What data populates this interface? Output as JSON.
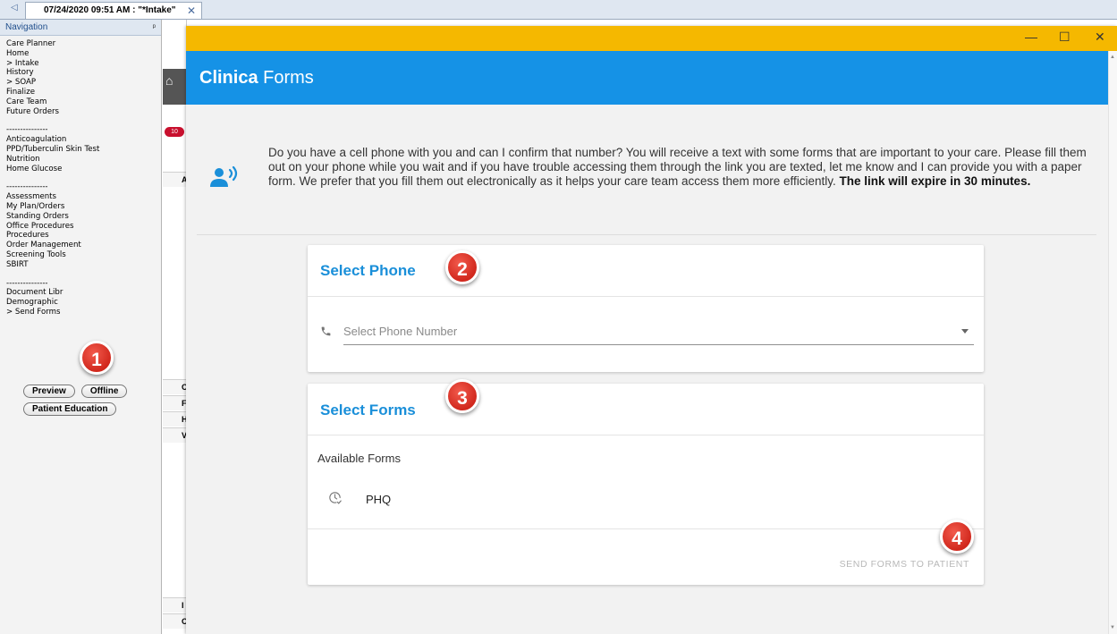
{
  "tab": {
    "arrow": "◁",
    "title": "07/24/2020 09:51 AM : \"*Intake\"",
    "close": "✕"
  },
  "nav": {
    "header": "Navigation",
    "pin": "ᵖ",
    "group1": [
      "Care Planner",
      "Home",
      "> Intake",
      "History",
      "> SOAP",
      "Finalize",
      "Care Team",
      "Future Orders"
    ],
    "group2": [
      "Anticoagulation",
      "PPD/Tuberculin Skin Test",
      "Nutrition",
      "Home Glucose"
    ],
    "group3": [
      "Assessments",
      "My Plan/Orders",
      "Standing Orders",
      "Office Procedures",
      "Procedures",
      "Order Management",
      "Screening Tools",
      "SBIRT"
    ],
    "group4": [
      "Document Libr",
      "Demographic",
      "> Send Forms"
    ],
    "separator": "---------------",
    "buttons": {
      "preview": "Preview",
      "offline": "Offline",
      "patient_education": "Patient Education"
    }
  },
  "background": {
    "home_icon": "⌂",
    "badge": "10",
    "row_letters": [
      "A",
      "C",
      "F",
      "H",
      "V",
      "I",
      "C"
    ]
  },
  "window": {
    "minimize": "—",
    "maximize": "☐",
    "close": "✕"
  },
  "app": {
    "brand": "Clinica",
    "title": " Forms"
  },
  "info": {
    "text": "Do you have a cell phone with you and can I confirm that number? You will receive a text with some forms that are important to your care. Please fill them out on your phone while you wait and if you have trouble accessing them through the link you are texted, let me know and I can provide you with a paper form. We prefer that you fill them out electronically as it helps your care team access them more efficiently. ",
    "emphasis": "The link will expire in 30 minutes."
  },
  "phone_card": {
    "title": "Select Phone",
    "placeholder": "Select Phone Number"
  },
  "forms_card": {
    "title": "Select Forms",
    "available_label": "Available Forms",
    "forms": [
      "PHQ"
    ],
    "send_button": "SEND FORMS TO PATIENT"
  },
  "callouts": [
    "1",
    "2",
    "3",
    "4"
  ],
  "colors": {
    "titlebar": "#f5b800",
    "appbar": "#1592e6",
    "card_title": "#1a8fd9",
    "callout": "#d1281d"
  }
}
